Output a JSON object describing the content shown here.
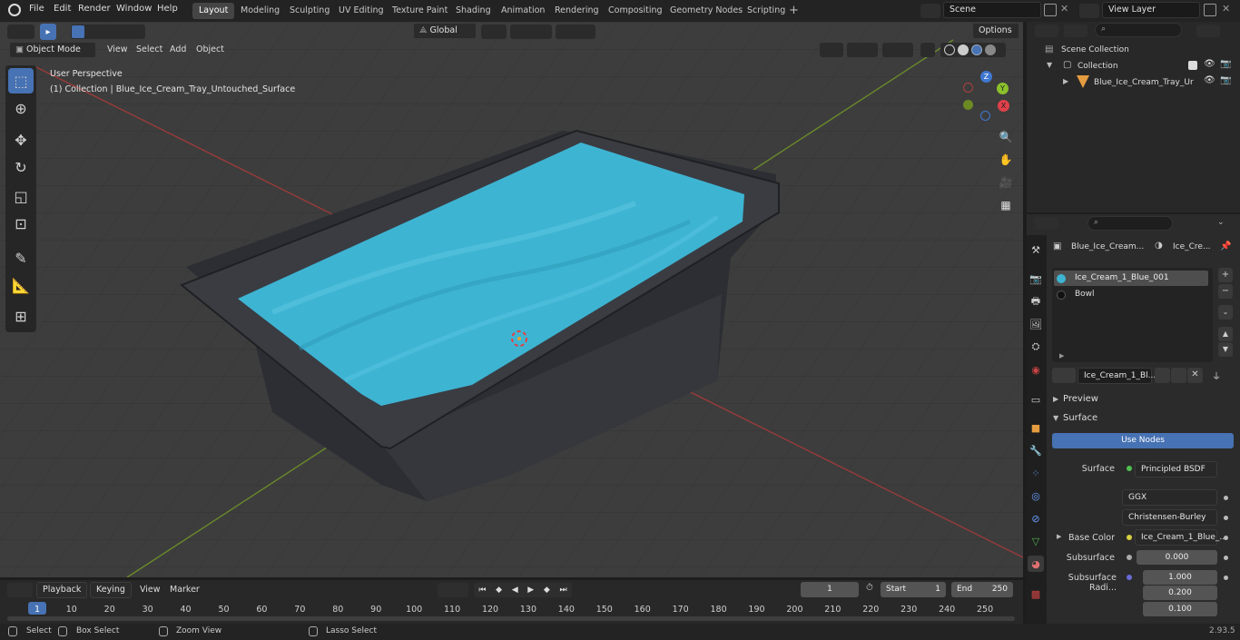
{
  "app": {
    "menu": [
      "File",
      "Edit",
      "Render",
      "Window",
      "Help"
    ]
  },
  "workspaces": [
    "Layout",
    "Modeling",
    "Sculpting",
    "UV Editing",
    "Texture Paint",
    "Shading",
    "Animation",
    "Rendering",
    "Compositing",
    "Geometry Nodes",
    "Scripting"
  ],
  "active_workspace": "Layout",
  "scene": {
    "name": "Scene",
    "view_layer": "View Layer"
  },
  "viewport": {
    "transform_orientation": "Global",
    "options_label": "Options",
    "mode": "Object Mode",
    "header_menu": [
      "View",
      "Select",
      "Add",
      "Object"
    ],
    "overlay_title": "User Perspective",
    "overlay_subtitle": "(1) Collection | Blue_Ice_Cream_Tray_Untouched_Surface",
    "gizmo_axes": {
      "x": "X",
      "y": "Y",
      "z": "Z"
    }
  },
  "outliner": {
    "scene_collection": "Scene Collection",
    "collection": "Collection",
    "object": "Blue_Ice_Cream_Tray_Ur"
  },
  "properties": {
    "object_name": "Blue_Ice_Cream...",
    "material_name_short": "Ice_Cre...",
    "material_slots": [
      "Ice_Cream_1_Blue_001",
      "Bowl"
    ],
    "material_field": "Ice_Cream_1_Bl...",
    "panels": {
      "preview": "Preview",
      "surface": "Surface"
    },
    "use_nodes": "Use Nodes",
    "surface_label": "Surface",
    "surface_value": "Principled BSDF",
    "distribution": "GGX",
    "subsurface_method": "Christensen-Burley",
    "base_color_label": "Base Color",
    "base_color_value": "Ice_Cream_1_Blue_...",
    "subsurface_label": "Subsurface",
    "subsurface_value": "0.000",
    "subsurface_radius_label": "Subsurface Radi...",
    "subsurface_radius": [
      "1.000",
      "0.200",
      "0.100"
    ]
  },
  "timeline": {
    "menu": [
      "Playback",
      "Keying",
      "View",
      "Marker"
    ],
    "current_frame": "1",
    "start_label": "Start",
    "start": "1",
    "end_label": "End",
    "end": "250",
    "ticks": [
      "1",
      "10",
      "20",
      "30",
      "40",
      "50",
      "60",
      "70",
      "80",
      "90",
      "100",
      "110",
      "120",
      "130",
      "140",
      "150",
      "160",
      "170",
      "180",
      "190",
      "200",
      "210",
      "220",
      "230",
      "240",
      "250"
    ]
  },
  "statusbar": {
    "select": "Select",
    "box_select": "Box Select",
    "zoom_view": "Zoom View",
    "lasso_select": "Lasso Select",
    "version": "2.93.5"
  },
  "colors": {
    "accent": "#4772b3",
    "ice_cream": "#3eb4d3",
    "tray": "#2e3036"
  }
}
